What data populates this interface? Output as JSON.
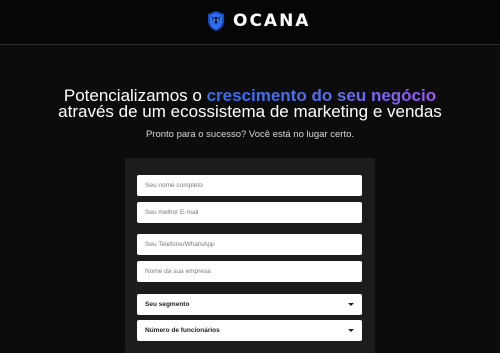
{
  "brand": {
    "name": "OCANA",
    "logo_icon": "lion-shield-icon",
    "accent_color": "#2f6ff2"
  },
  "hero": {
    "headline_prefix": "Potencializamos o ",
    "headline_highlight": "crescimento do seu negócio",
    "headline_line2": "através de um ecossistema de marketing e vendas",
    "subtitle": "Pronto para o sucesso? Você está no lugar certo.",
    "highlight_gradient": [
      "#2f6ff2",
      "#9b5af0"
    ]
  },
  "form": {
    "name_placeholder": "Seu nome completo",
    "email_placeholder": "Seu melhor E-mail",
    "phone_placeholder": "Seu Telefone/WhatsApp",
    "company_placeholder": "Nome da sua empresa",
    "segment_label": "Seu segmento",
    "employees_label": "Número de funcionários"
  }
}
